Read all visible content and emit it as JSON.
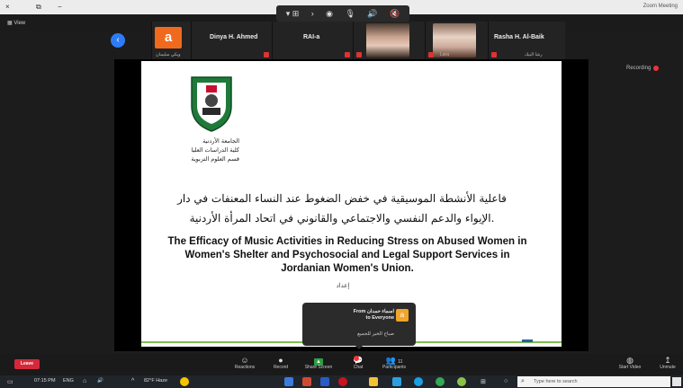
{
  "title_bar": {
    "app_title": "Zoom Meeting",
    "close": "×",
    "restore": "⧉",
    "minimize": "−"
  },
  "view_button": "View",
  "speaker_controls": {
    "mode": "▾ ⊞",
    "next": "›",
    "items": [
      "◉",
      "🎙",
      "🔊",
      "🔇"
    ]
  },
  "participants": [
    {
      "name": "Rasha H. Al-Baik",
      "sub": "رشا البيك"
    },
    {
      "name": "",
      "sub": "Lara"
    },
    {
      "name": "RAI-a",
      "sub": ""
    },
    {
      "name": "Dinya H. Ahmed",
      "sub": ""
    },
    {
      "name": "",
      "sub": "ويكي سليمان"
    }
  ],
  "avatar_letter": "a",
  "recording_label": "Recording",
  "slide": {
    "university_caption": [
      "الجامعة الأردنية",
      "كلية الدراسات العليا",
      "قسم العلوم التربوية"
    ],
    "arabic_title_line1": "فاعلية الأنشطة الموسيقية في خفض الضغوط عند النساء المعنفات في دار",
    "arabic_title_line2": "الإيواء والدعم النفسي والاجتماعي والقانوني في اتحاد المرأة الأردنية.",
    "english_title": "The Efficacy of Music Activities in Reducing Stress on Abused Women in Women's Shelter and Psychosocial and Legal Support Services in Jordanian Women's Union.",
    "arabic_sub": "إعداد"
  },
  "chat_popup": {
    "icon": "a",
    "from": "From اسماء حمدان to Everyone",
    "message": "صباح الخير للجميع"
  },
  "toolbar": {
    "leave": "Leave",
    "items": [
      {
        "icon": "↥",
        "label": "Unmute"
      },
      {
        "icon": "◍",
        "label": "Start Video"
      },
      {
        "icon": "👥",
        "label": "Participants",
        "count": "11"
      },
      {
        "icon": "💬",
        "label": "Chat"
      },
      {
        "icon": "▲",
        "label": "Share Screen"
      },
      {
        "icon": "●",
        "label": "Record"
      },
      {
        "icon": "☺",
        "label": "Reactions"
      }
    ]
  },
  "taskbar": {
    "search_placeholder": "Type here to search",
    "weather": "82°F Haze",
    "time": "07:15 PM",
    "date": "01-Jun-21",
    "lang": "ENG"
  }
}
